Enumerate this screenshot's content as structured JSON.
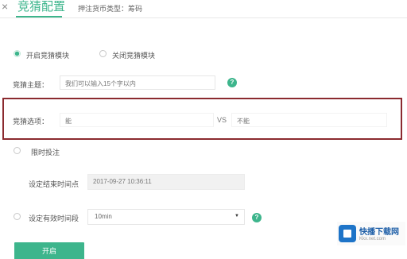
{
  "header": {
    "close_glyph": "×",
    "active_tab": "竞猜配置",
    "other_tab": "押注货币类型：筹码"
  },
  "mode_options": [
    {
      "label": "开启竞猜模块",
      "selected": true
    },
    {
      "label": "关闭竞猜模块",
      "selected": false
    }
  ],
  "topic": {
    "label": "竞猜主题：",
    "placeholder": "我们可以输入15个字以内"
  },
  "options": {
    "label": "竞猜选项：",
    "option_a": "能",
    "vs": "VS",
    "option_b": "不能"
  },
  "timed": {
    "label": "限时投注"
  },
  "end_time": {
    "label": "设定结束时间点",
    "value": "2017-09-27 10:36:11"
  },
  "duration": {
    "label": "设定有效时间段",
    "value": "10min"
  },
  "start_button": "开启",
  "watermark": {
    "title": "快播下载网",
    "url": "Kkx.net.com"
  },
  "colors": {
    "accent": "#3db58c",
    "highlight_border": "#8b2a2f",
    "watermark_blue": "#1e74c8"
  },
  "icons": {
    "help": "help-icon",
    "close": "close-icon",
    "caret": "chevron-down-icon"
  }
}
